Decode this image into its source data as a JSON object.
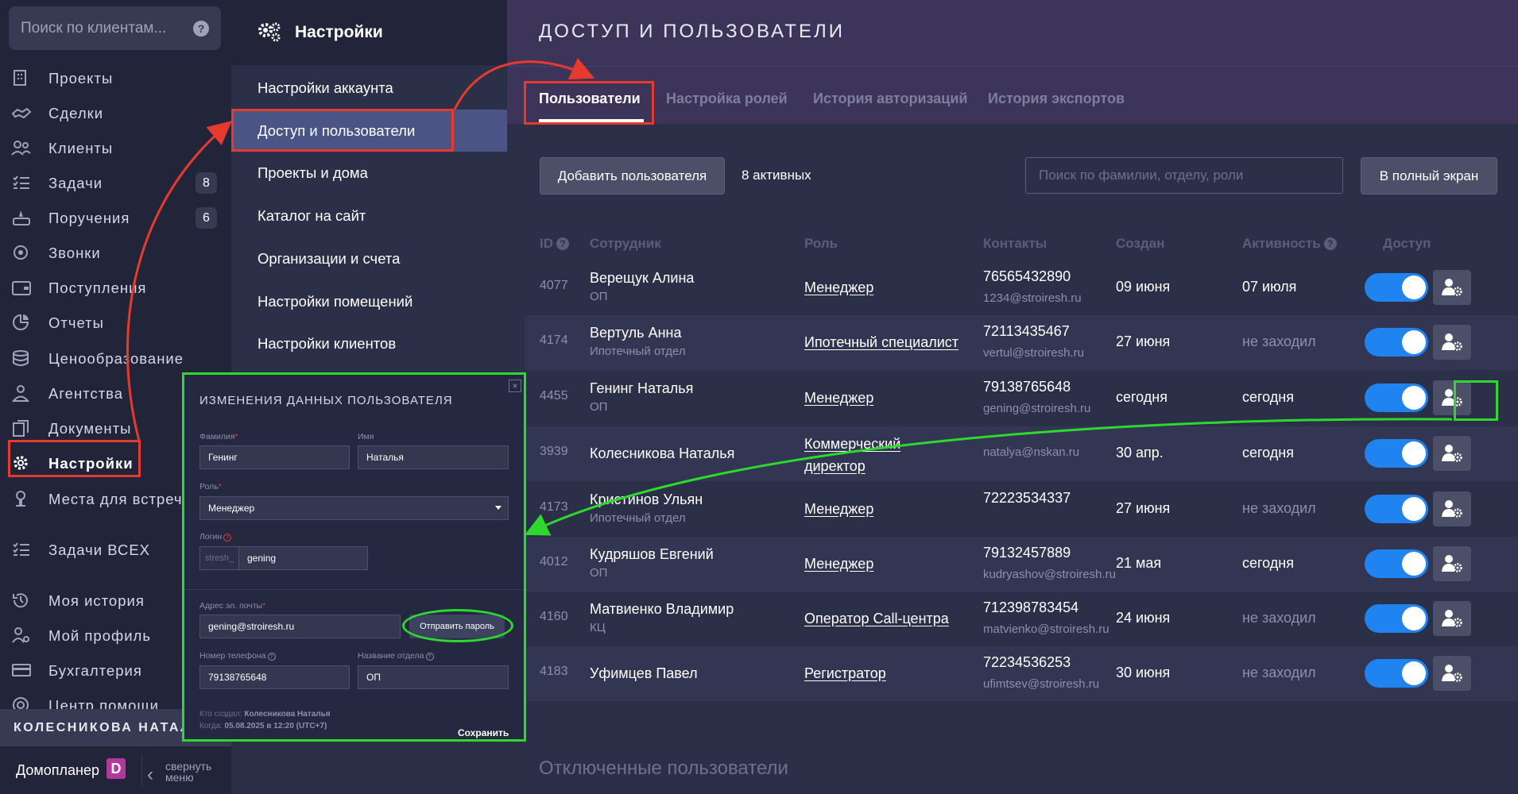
{
  "global_search": {
    "placeholder": "Поиск по клиентам...",
    "help_icon": "question-circle-icon"
  },
  "nav": {
    "items": [
      {
        "label": "Проекты",
        "icon": "building-icon"
      },
      {
        "label": "Сделки",
        "icon": "handshake-icon"
      },
      {
        "label": "Клиенты",
        "icon": "users-icon"
      },
      {
        "label": "Задачи",
        "icon": "tasks-icon",
        "badge": "8"
      },
      {
        "label": "Поручения",
        "icon": "assign-icon",
        "badge": "6"
      },
      {
        "label": "Звонки",
        "icon": "phone-icon"
      },
      {
        "label": "Поступления",
        "icon": "wallet-icon"
      },
      {
        "label": "Отчеты",
        "icon": "chart-icon"
      },
      {
        "label": "Ценообразование",
        "icon": "coins-icon"
      },
      {
        "label": "Агентства",
        "icon": "agent-icon"
      },
      {
        "label": "Документы",
        "icon": "documents-icon"
      },
      {
        "label": "Настройки",
        "icon": "gear-icon",
        "active": true
      },
      {
        "label": "Места для встреч",
        "icon": "meeting-icon"
      },
      {
        "label": "Задачи ВСЕХ",
        "icon": "tasks-icon"
      },
      {
        "label": "Моя история",
        "icon": "history-icon"
      },
      {
        "label": "Мой профиль",
        "icon": "profile-icon"
      },
      {
        "label": "Бухгалтерия",
        "icon": "accounting-icon"
      },
      {
        "label": "Центр помощи",
        "icon": "help-icon"
      }
    ],
    "current_user": "КОЛЕСНИКОВА НАТАЛЬЯ",
    "brand": "Домопланер",
    "brand_logo_letter": "D",
    "collapse_label_1": "свернуть",
    "collapse_label_2": "меню"
  },
  "settings": {
    "title": "Настройки",
    "items": [
      {
        "label": "Настройки аккаунта"
      },
      {
        "label": "Доступ и пользователи",
        "active": true
      },
      {
        "label": "Проекты и дома"
      },
      {
        "label": "Каталог на сайт"
      },
      {
        "label": "Организации и счета"
      },
      {
        "label": "Настройки помещений"
      },
      {
        "label": "Настройки клиентов"
      }
    ]
  },
  "main": {
    "title": "ДОСТУП И ПОЛЬЗОВАТЕЛИ",
    "tabs": [
      {
        "label": "Пользователи",
        "active": true
      },
      {
        "label": "Настройка ролей"
      },
      {
        "label": "История авторизаций"
      },
      {
        "label": "История экспортов"
      }
    ],
    "add_user_label": "Добавить пользователя",
    "active_count": "8 активных",
    "search_placeholder": "Поиск по фамилии, отделу, роли",
    "fullscreen_label": "В полный экран",
    "columns": {
      "id": "ID",
      "employee": "Сотрудник",
      "role": "Роль",
      "contacts": "Контакты",
      "created": "Создан",
      "activity": "Активность",
      "access": "Доступ"
    },
    "users": [
      {
        "id": "4077",
        "name": "Верещук Алина",
        "dept": "ОП",
        "role": "Менеджер",
        "phone": "76565432890",
        "email": "1234@stroiresh.ru",
        "created": "09 июня",
        "activity": "07 июля",
        "access": true
      },
      {
        "id": "4174",
        "name": "Вертуль Анна",
        "dept": "Ипотечный отдел",
        "role": "Ипотечный специалист",
        "phone": "72113435467",
        "email": "vertul@stroiresh.ru",
        "created": "27 июня",
        "activity": "не заходил",
        "access": true
      },
      {
        "id": "4455",
        "name": "Генинг Наталья",
        "dept": "ОП",
        "role": "Менеджер",
        "phone": "79138765648",
        "email": "gening@stroiresh.ru",
        "created": "сегодня",
        "activity": "сегодня",
        "access": true
      },
      {
        "id": "3939",
        "name": "Колесникова Наталья",
        "dept": "",
        "role_line1": "Коммерческий",
        "role_line2": "директор",
        "phone": "",
        "email": "natalya@nskan.ru",
        "created": "30 апр.",
        "activity": "сегодня",
        "access": true
      },
      {
        "id": "4173",
        "name": "Кристинов Ульян",
        "dept": "Ипотечный отдел",
        "role": "Менеджер",
        "phone": "72223534337",
        "email": "",
        "created": "27 июня",
        "activity": "не заходил",
        "access": true
      },
      {
        "id": "4012",
        "name": "Кудряшов Евгений",
        "dept": "ОП",
        "role": "Менеджер",
        "phone": "79132457889",
        "email": "kudryashov@stroiresh.ru",
        "created": "21 мая",
        "activity": "сегодня",
        "access": true
      },
      {
        "id": "4160",
        "name": "Матвиенко Владимир",
        "dept": "КЦ",
        "role": "Оператор Call-центра",
        "phone": "712398783454",
        "email": "matvienko@stroiresh.ru",
        "created": "24 июня",
        "activity": "не заходил",
        "access": true
      },
      {
        "id": "4183",
        "name": "Уфимцев Павел",
        "dept": "",
        "role": "Регистратор",
        "phone": "72234536253",
        "email": "ufimtsev@stroiresh.ru",
        "created": "30 июня",
        "activity": "не заходил",
        "access": true
      }
    ],
    "disabled_title": "Отключенные пользователи"
  },
  "modal": {
    "title": "ИЗМЕНЕНИЯ ДАННЫХ ПОЛЬЗОВАТЕЛЯ",
    "close_glyph": "×",
    "lastname_label": "Фамилия",
    "lastname_value": "Генинг",
    "firstname_label": "Имя",
    "firstname_value": "Наталья",
    "role_label": "Роль",
    "role_value": "Менеджер",
    "login_label": "Логин",
    "login_prefix": "stresh_",
    "login_value": "gening",
    "email_label": "Адрес эл. почты",
    "email_value": "gening@stroiresh.ru",
    "send_password_label": "Отправить пароль",
    "phone_label": "Номер телефона",
    "phone_value": "79138765648",
    "dept_label": "Название отдела",
    "dept_value": "ОП",
    "created_by_prefix": "Кто создал:",
    "created_by": "Колесникова Наталья",
    "created_at_prefix": "Когда:",
    "created_at": "05.08.2025 в 12:20 (UTC+7)",
    "save_label": "Сохранить"
  },
  "colors": {
    "accent_toggle": "#1f84f0",
    "annotation_red": "#e63a2e",
    "annotation_green": "#2ed92e",
    "brand_logo": "#b03a9b"
  }
}
